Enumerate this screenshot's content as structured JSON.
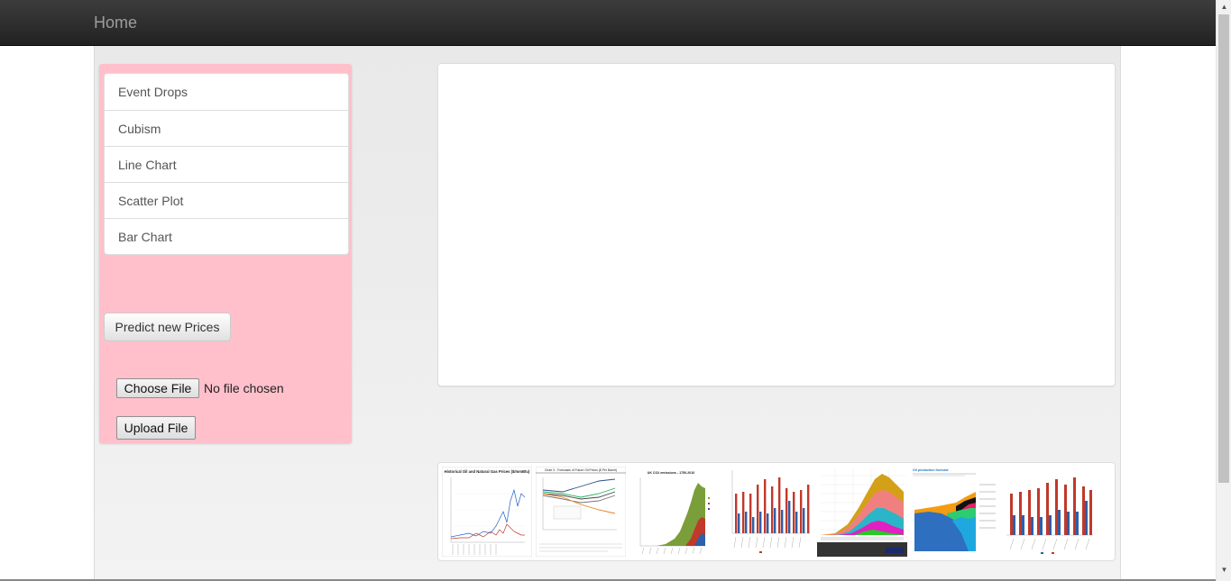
{
  "navbar": {
    "brand": "Home"
  },
  "sidebar": {
    "items": [
      {
        "label": "Event Drops"
      },
      {
        "label": "Cubism"
      },
      {
        "label": "Line Chart"
      },
      {
        "label": "Scatter Plot"
      },
      {
        "label": "Bar Chart"
      }
    ],
    "predict_label": "Predict new Prices",
    "file": {
      "choose_label": "Choose File",
      "status": "No file chosen",
      "upload_label": "Upload File"
    },
    "background_color": "#ffc0cb"
  },
  "thumbnails": {
    "items": [
      {
        "title": "Historical Oil and Natural Gas Prices ($/mmBtu)",
        "icon": "line-chart-thumb"
      },
      {
        "title": "Chart 3 - Forecasts of Future Oil Prices ($ Per Barrel)",
        "icon": "line-chart-thumb"
      },
      {
        "title": "UK CO2 emissions - 1750-2010",
        "icon": "area-chart-thumb"
      },
      {
        "title": "",
        "icon": "bar-chart-thumb"
      },
      {
        "title": "",
        "icon": "stacked-area-thumb"
      },
      {
        "title": "Oil production forecast",
        "icon": "stacked-area-thumb"
      },
      {
        "title": "",
        "icon": "bar-chart-thumb"
      }
    ]
  }
}
